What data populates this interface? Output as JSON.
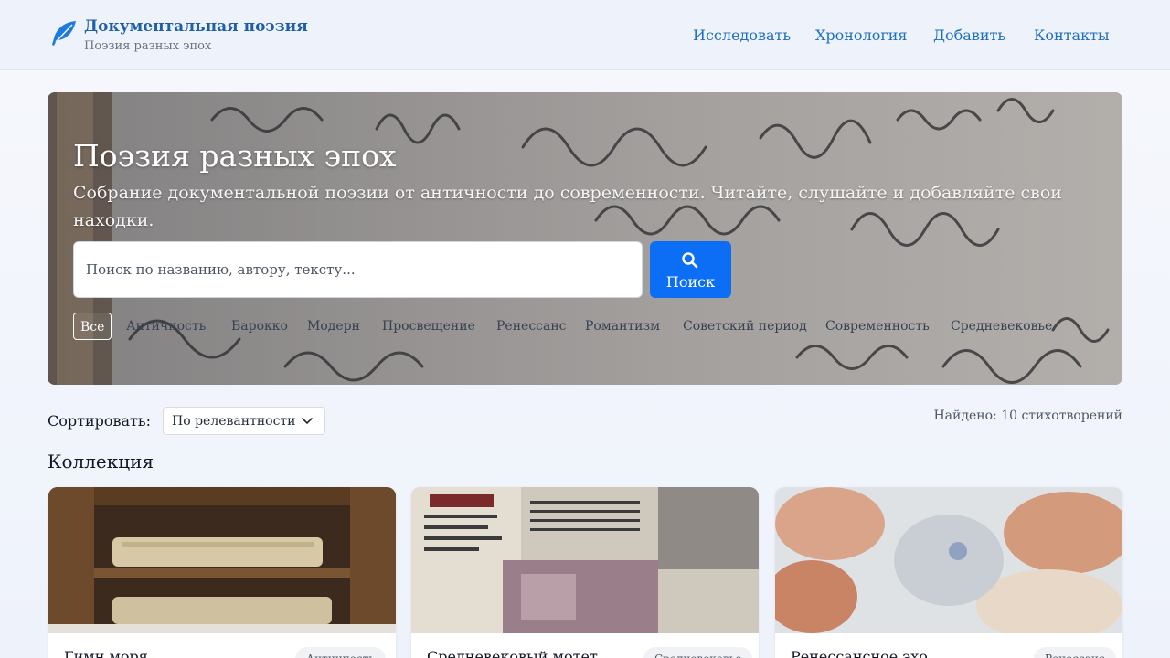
{
  "brand": {
    "title": "Документальная поэзия",
    "subtitle": "Поэзия разных эпох",
    "icon": "feather-icon"
  },
  "nav": {
    "items": [
      {
        "label": "Исследовать"
      },
      {
        "label": "Хронология"
      },
      {
        "label": "Добавить"
      },
      {
        "label": "Контакты"
      }
    ]
  },
  "hero": {
    "title": "Поэзия разных эпох",
    "description": "Собрание документальной поэзии от античности до современности. Читайте, слушайте и добавляйте свои находки.",
    "search": {
      "placeholder": "Поиск по названию, автору, тексту...",
      "value": "",
      "button_label": "Поиск",
      "icon": "search-icon"
    },
    "filters": [
      {
        "label": "Все",
        "active": true
      },
      {
        "label": "Античность",
        "active": false
      },
      {
        "label": "Барокко",
        "active": false
      },
      {
        "label": "Модерн",
        "active": false
      },
      {
        "label": "Просвещение",
        "active": false
      },
      {
        "label": "Ренессанс",
        "active": false
      },
      {
        "label": "Романтизм",
        "active": false
      },
      {
        "label": "Советский период",
        "active": false
      },
      {
        "label": "Современность",
        "active": false
      },
      {
        "label": "Средневековье",
        "active": false
      }
    ]
  },
  "toolbar": {
    "sort_label": "Сортировать:",
    "sort_value": "По релевантности",
    "found_text": "Найдено: 10 стихотворений"
  },
  "collection": {
    "title": "Коллекция",
    "cards": [
      {
        "title": "Гимн моря",
        "badge": "Античность"
      },
      {
        "title": "Средневековый мотет",
        "badge": "Средневековье"
      },
      {
        "title": "Ренессансное эхо",
        "badge": "Ренессанс"
      }
    ]
  },
  "colors": {
    "accent": "#0b6ef5",
    "brand": "#1f5fa8",
    "nav_link": "#1f6fbf"
  }
}
